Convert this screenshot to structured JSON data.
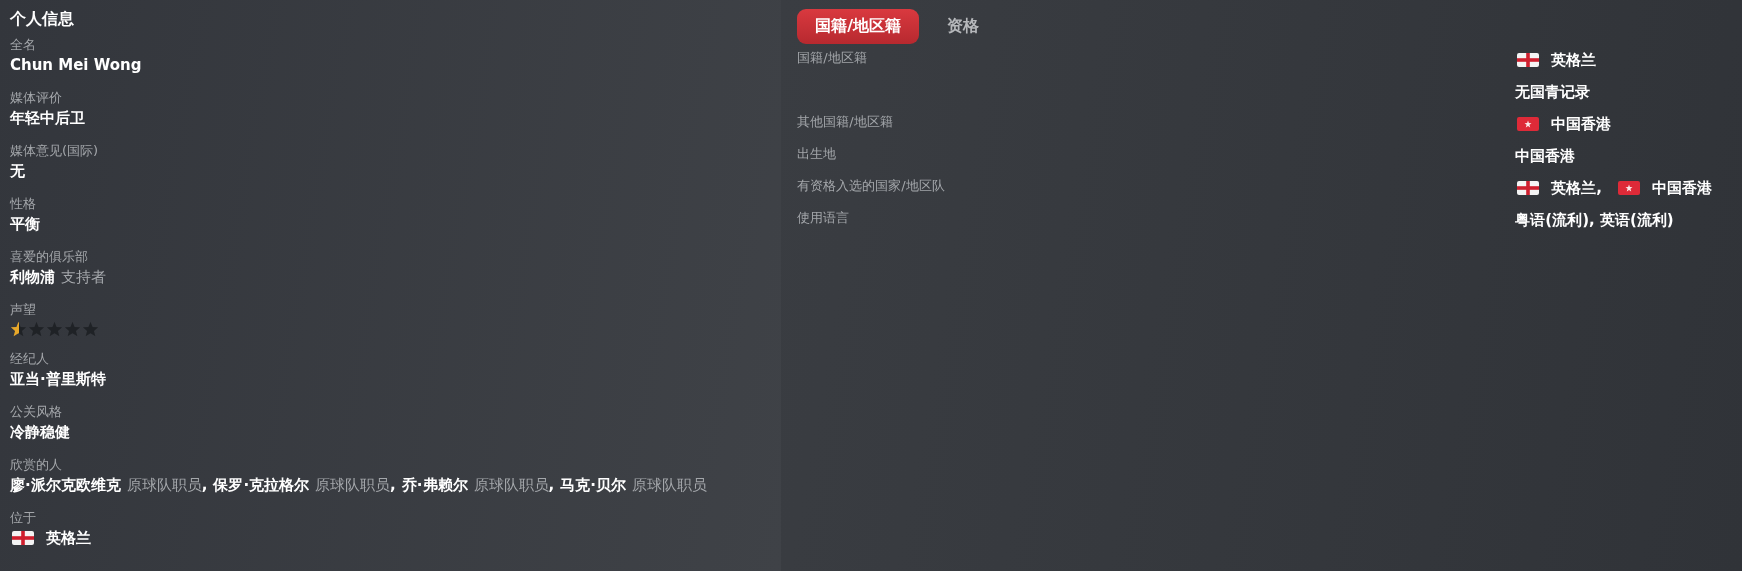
{
  "personal_info": {
    "title": "个人信息",
    "fields": [
      {
        "kind": "text",
        "label": "全名",
        "value": "Chun Mei Wong"
      },
      {
        "kind": "text",
        "label": "媒体评价",
        "value": "年轻中后卫"
      },
      {
        "kind": "text",
        "label": "媒体意见(国际)",
        "value": "无"
      },
      {
        "kind": "text",
        "label": "性格",
        "value": "平衡"
      },
      {
        "kind": "club",
        "label": "喜爱的俱乐部",
        "value": "利物浦",
        "note": "支持者"
      },
      {
        "kind": "stars",
        "label": "声望",
        "stars": 0.5
      },
      {
        "kind": "text",
        "label": "经纪人",
        "value": "亚当·普里斯特"
      },
      {
        "kind": "text",
        "label": "公关风格",
        "value": "冷静稳健"
      },
      {
        "kind": "people",
        "label": "欣赏的人",
        "people": [
          {
            "name": "廖·派尔克欧维克",
            "role": "原球队职员",
            "separator": ","
          },
          {
            "name": "保罗·克拉格尔",
            "role": "原球队职员",
            "separator": ","
          },
          {
            "name": "乔·弗赖尔",
            "role": "原球队职员",
            "separator": ","
          },
          {
            "name": "马克·贝尔",
            "role": "原球队职员"
          }
        ]
      },
      {
        "kind": "place",
        "label": "位于",
        "places": [
          {
            "kind": "england_flag",
            "text": "英格兰"
          }
        ]
      }
    ]
  },
  "nationality": {
    "tabs": [
      {
        "label": "国籍/地区籍",
        "selected": true
      },
      {
        "label": "资格",
        "selected": false
      }
    ],
    "rows": [
      {
        "label": "国籍/地区籍",
        "lines": [
          [
            {
              "kind": "england_flag",
              "text": "英格兰"
            }
          ],
          [
            {
              "kind": "plain",
              "text": "无国青记录"
            }
          ]
        ]
      },
      {
        "label": "其他国籍/地区籍",
        "lines": [
          [
            {
              "kind": "hong_kong_flag",
              "text": "中国香港"
            }
          ]
        ]
      },
      {
        "label": "出生地",
        "lines": [
          [
            {
              "kind": "plain",
              "text": "中国香港"
            }
          ]
        ]
      },
      {
        "label": "有资格入选的国家/地区队",
        "lines": [
          [
            {
              "kind": "england_flag",
              "text": "英格兰,"
            },
            {
              "kind": "hong_kong_flag",
              "text": "中国香港"
            }
          ]
        ]
      },
      {
        "label": "使用语言",
        "lines": [
          [
            {
              "kind": "plain",
              "text": "粤语(流利), 英语(流利)"
            }
          ]
        ]
      }
    ]
  }
}
